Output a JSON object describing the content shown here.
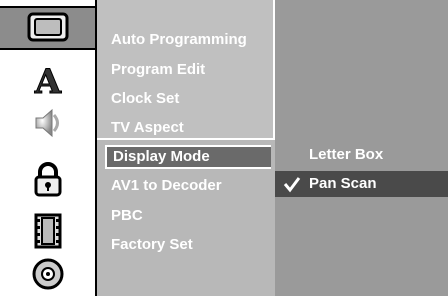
{
  "icons": [
    "tv-icon",
    "language-icon",
    "audio-icon",
    "lock-icon",
    "film-icon",
    "disc-icon"
  ],
  "menu": {
    "items": [
      {
        "label": "Auto Programming"
      },
      {
        "label": "Program Edit"
      },
      {
        "label": "Clock Set"
      },
      {
        "label": "TV Aspect"
      },
      {
        "label": "Display Mode"
      },
      {
        "label": "AV1 to Decoder"
      },
      {
        "label": "PBC"
      },
      {
        "label": "Factory Set"
      }
    ],
    "active_index": 4
  },
  "options": {
    "items": [
      {
        "label": "Letter Box",
        "checked": false
      },
      {
        "label": "Pan Scan",
        "checked": true
      }
    ]
  },
  "colors": {
    "menu_bg": "#b8b8b8",
    "options_bg": "#9a9a9a",
    "highlight": "#4a4a4a",
    "text": "#ffffff"
  }
}
